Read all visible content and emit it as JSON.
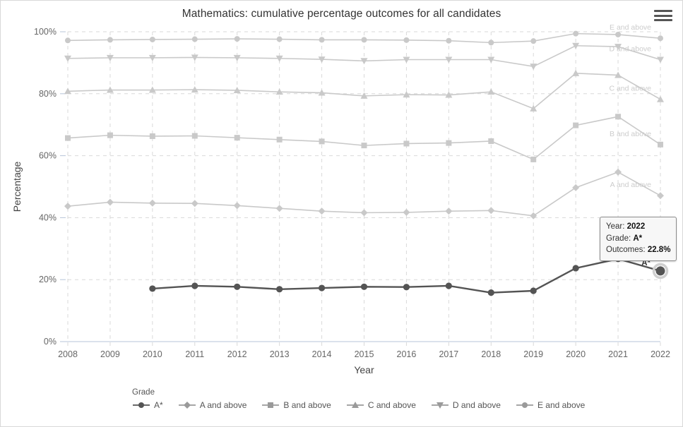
{
  "header": {
    "title": "Mathematics: cumulative percentage outcomes for all candidates",
    "menu_icon": "hamburger-menu-icon"
  },
  "tooltip": {
    "year_label": "Year:",
    "year_value": "2022",
    "grade_label": "Grade:",
    "grade_value": "A*",
    "outcomes_label": "Outcomes:",
    "outcomes_value": "22.8%"
  },
  "legend": {
    "title": "Grade",
    "items": [
      {
        "label": "A*",
        "marker": "circle",
        "color": "#545454"
      },
      {
        "label": "A and above",
        "marker": "diamond",
        "color": "#9a9a9a"
      },
      {
        "label": "B and above",
        "marker": "square",
        "color": "#9a9a9a"
      },
      {
        "label": "C and above",
        "marker": "triangle-up",
        "color": "#9a9a9a"
      },
      {
        "label": "D and above",
        "marker": "triangle-down",
        "color": "#9a9a9a"
      },
      {
        "label": "E and above",
        "marker": "circle",
        "color": "#9a9a9a"
      }
    ]
  },
  "point_annotation": {
    "label": "A*"
  },
  "chart_data": {
    "type": "line",
    "title": "Mathematics: cumulative percentage outcomes for all candidates",
    "xlabel": "Year",
    "ylabel": "Percentage",
    "x": [
      2008,
      2009,
      2010,
      2011,
      2012,
      2013,
      2014,
      2015,
      2016,
      2017,
      2018,
      2019,
      2020,
      2021,
      2022
    ],
    "xlim": [
      2008,
      2022
    ],
    "ylim": [
      0,
      100
    ],
    "yticks": [
      0,
      20,
      40,
      60,
      80,
      100
    ],
    "ytick_labels": [
      "0%",
      "20%",
      "40%",
      "60%",
      "80%",
      "100%"
    ],
    "grid": true,
    "legend_position": "bottom",
    "series": [
      {
        "name": "E and above",
        "marker": "circle",
        "color": "#c9c9c9",
        "label_right": "E and above",
        "values": [
          97.2,
          97.4,
          97.5,
          97.6,
          97.7,
          97.6,
          97.4,
          97.4,
          97.3,
          97.1,
          96.5,
          97.0,
          99.4,
          99.1,
          97.9
        ]
      },
      {
        "name": "D and above",
        "marker": "triangle-down",
        "color": "#c9c9c9",
        "label_right": "D and above",
        "values": [
          91.4,
          91.6,
          91.6,
          91.7,
          91.6,
          91.4,
          91.1,
          90.6,
          91.0,
          91.0,
          91.0,
          88.8,
          95.5,
          95.2,
          91.0
        ]
      },
      {
        "name": "C and above",
        "marker": "triangle-up",
        "color": "#c9c9c9",
        "label_right": "C and above",
        "values": [
          80.8,
          81.2,
          81.2,
          81.3,
          81.1,
          80.6,
          80.3,
          79.3,
          79.7,
          79.6,
          80.6,
          75.2,
          86.6,
          86.0,
          78.2
        ]
      },
      {
        "name": "B and above",
        "marker": "square",
        "color": "#c9c9c9",
        "label_right": "B and above",
        "values": [
          65.7,
          66.6,
          66.3,
          66.4,
          65.8,
          65.2,
          64.6,
          63.3,
          63.9,
          64.1,
          64.7,
          58.8,
          69.8,
          72.6,
          63.6
        ]
      },
      {
        "name": "A and above",
        "marker": "diamond",
        "color": "#c9c9c9",
        "label_right": "A and above",
        "values": [
          43.7,
          45.0,
          44.7,
          44.6,
          43.9,
          43.0,
          42.1,
          41.6,
          41.7,
          42.1,
          42.3,
          40.6,
          49.7,
          54.7,
          47.1
        ]
      },
      {
        "name": "A*",
        "marker": "circle",
        "color": "#545454",
        "label_right": null,
        "values": [
          null,
          null,
          17.1,
          18.0,
          17.7,
          16.9,
          17.3,
          17.7,
          17.6,
          18.0,
          15.8,
          16.4,
          23.7,
          26.7,
          22.8
        ]
      }
    ],
    "highlight_point": {
      "series": "A*",
      "x": 2022,
      "y": 22.8
    }
  }
}
